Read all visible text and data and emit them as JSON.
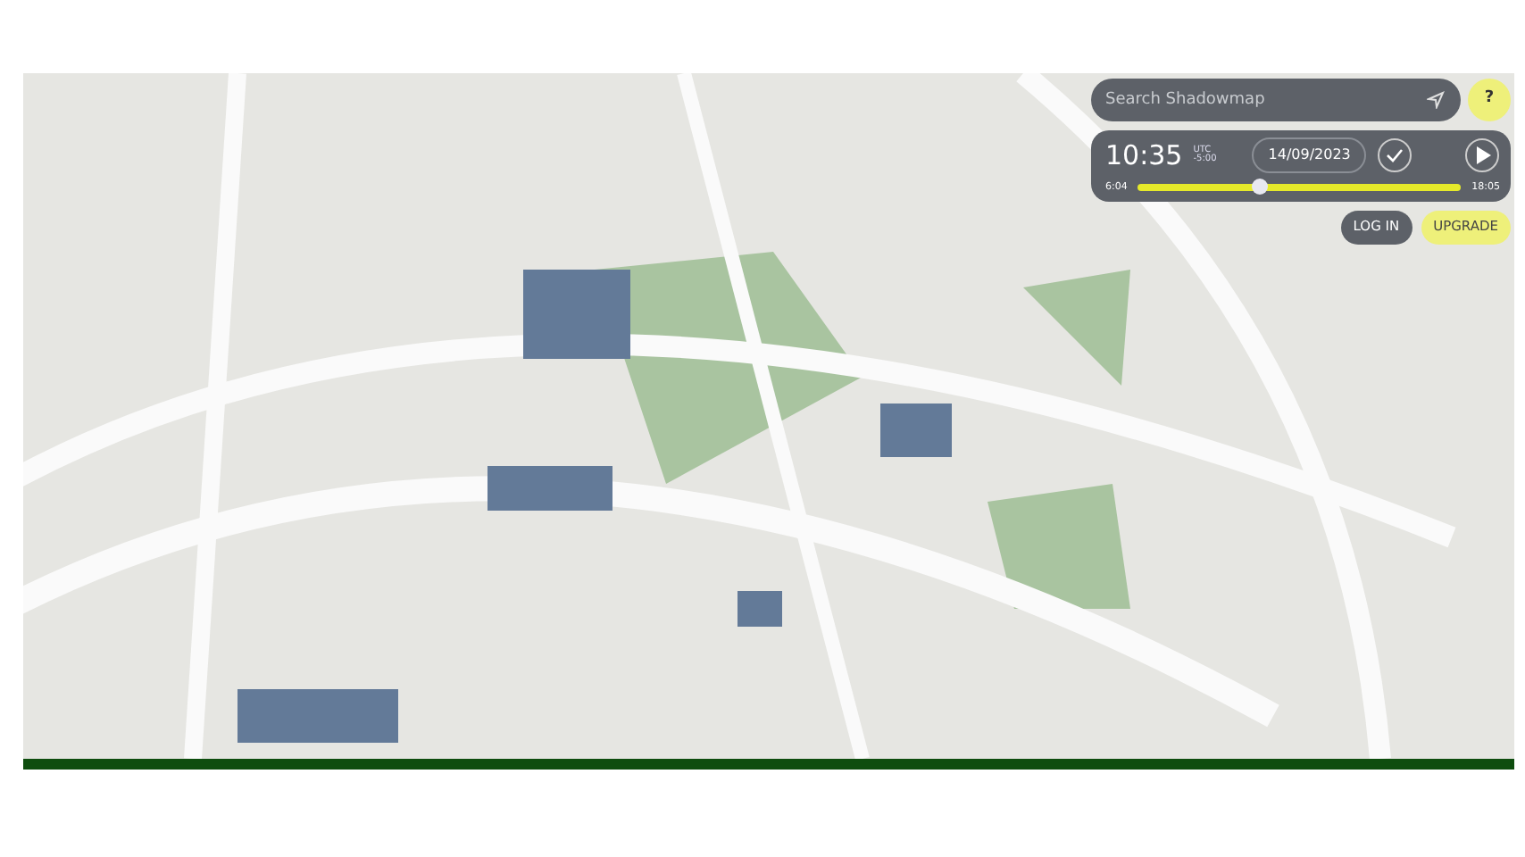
{
  "search": {
    "placeholder": "Search Shadowmap"
  },
  "help_button": "?",
  "time_panel": {
    "time": "10:35",
    "timezone_label": "UTC",
    "timezone_offset": "-5:00",
    "date": "14/09/2023",
    "slider": {
      "start": "6:04",
      "end": "18:05",
      "level": 0.375
    }
  },
  "buttons": [
    {
      "label": "LOG IN",
      "kind": "secondary"
    },
    {
      "label": "UPGRADE",
      "kind": "primary"
    }
  ]
}
